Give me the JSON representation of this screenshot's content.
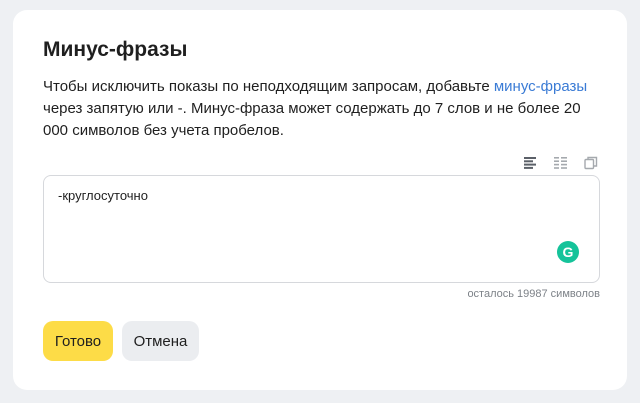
{
  "dialog": {
    "title": "Минус-фразы",
    "description_before": "Чтобы исключить показы по неподходящим запросам, добавьте ",
    "description_link": "минус-фразы",
    "description_after": " через запятую или -. Минус-фраза может содержать до 7 слов и не более 20 000 символов без учета пробелов."
  },
  "toolbar": {
    "icons": [
      "align-left-icon",
      "align-justify-icon",
      "copy-icon"
    ]
  },
  "editor": {
    "value": "-круглосуточно",
    "grammarly_icon": "G"
  },
  "counter": "осталось 19987 символов",
  "buttons": {
    "done": "Готово",
    "cancel": "Отмена"
  },
  "colors": {
    "primary_button": "#fddc47",
    "link": "#3a7bd5",
    "grammarly": "#15c39a"
  }
}
